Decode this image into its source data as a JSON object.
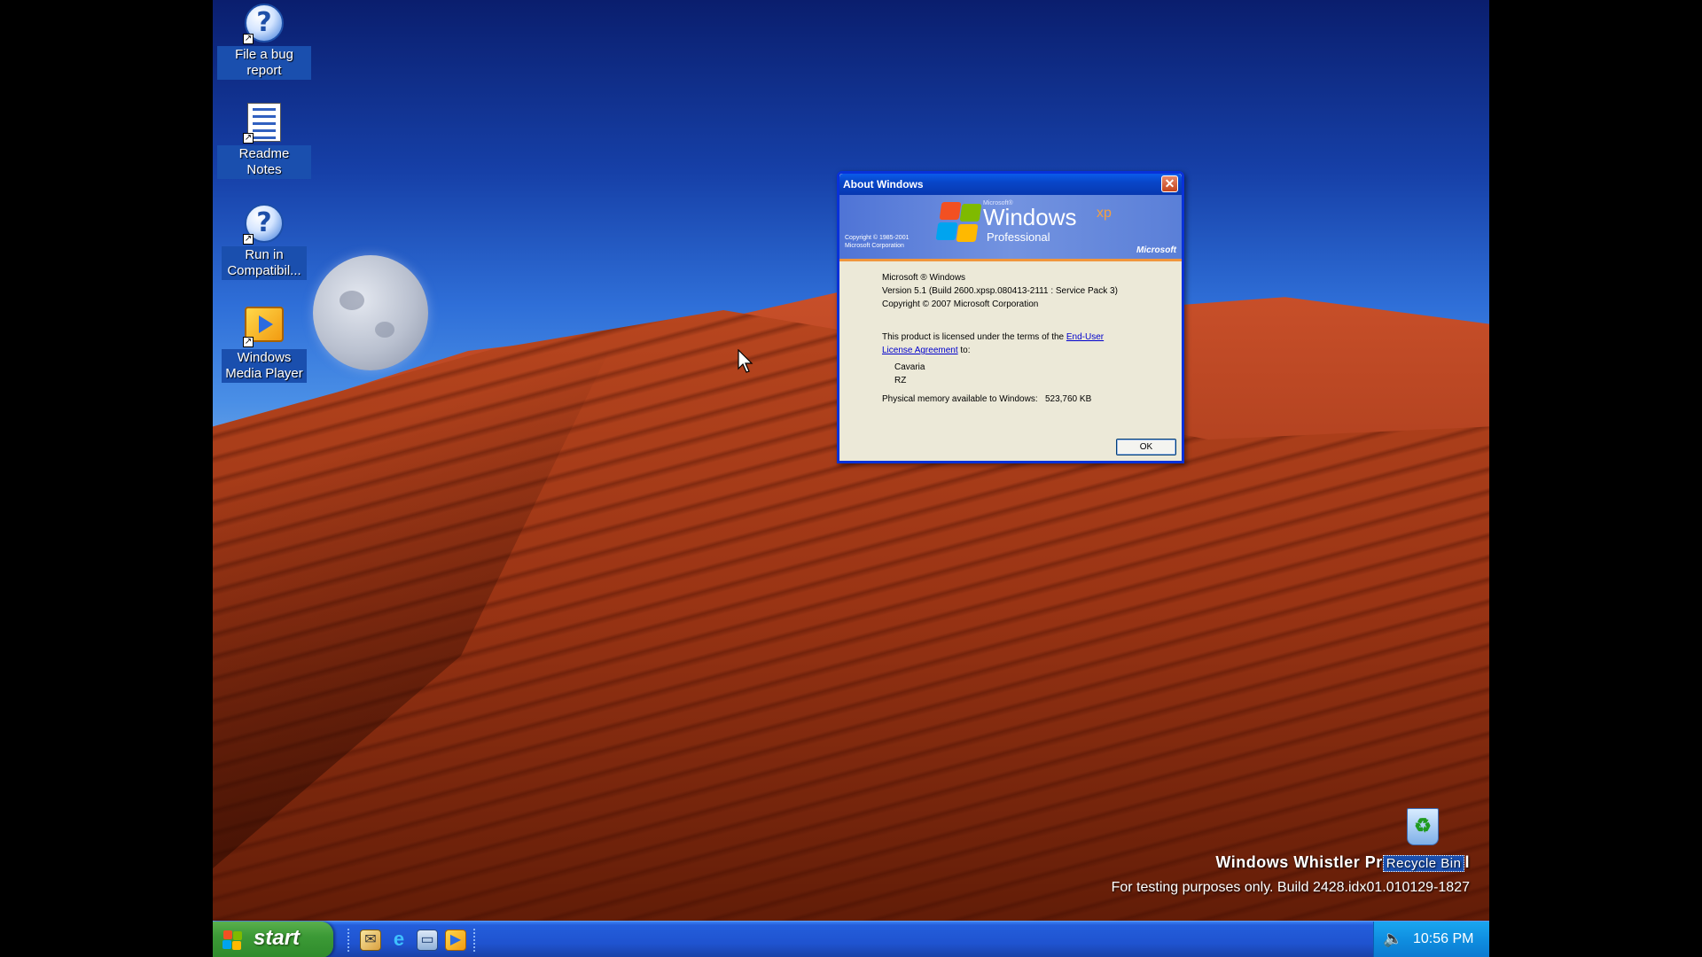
{
  "desktop": {
    "icons": [
      {
        "label": "File a bug report",
        "icon": "help-icon"
      },
      {
        "label": "Readme Notes",
        "icon": "notes-icon"
      },
      {
        "label": "Run in Compatibil...",
        "icon": "help-icon"
      },
      {
        "label": "Windows Media Player",
        "icon": "media-player-icon"
      }
    ],
    "recycle_bin": {
      "label": "Recycle Bin",
      "icon": "recycle-bin-icon"
    }
  },
  "dialog": {
    "title": "About Windows",
    "close_glyph": "✕",
    "banner": {
      "copyright_line1": "Copyright © 1985-2001",
      "copyright_line2": "Microsoft Corporation",
      "microsoft_small": "Microsoft®",
      "windows": "Windows",
      "xp": "xp",
      "edition": "Professional",
      "microsoft_logo": "Microsoft"
    },
    "info_line1": "Microsoft ® Windows",
    "info_line2": "Version 5.1 (Build 2600.xpsp.080413-2111 : Service Pack 3)",
    "info_line3": "Copyright © 2007 Microsoft Corporation",
    "license_text": "This product is licensed under the terms of the ",
    "license_link1": "End-User",
    "license_link2": "License Agreement",
    "license_to": " to:",
    "licensee_name": "Cavaria",
    "licensee_org": "RZ",
    "memory_label": "Physical memory available to Windows:",
    "memory_value": "523,760 KB",
    "ok_label": "OK"
  },
  "watermark": {
    "line1": "Windows Whistler Pr",
    "line1_end": "l",
    "line2": "For testing purposes only. Build 2428.idx01.010129-1827"
  },
  "taskbar": {
    "start_label": "start",
    "quick_launch": [
      "email-icon",
      "internet-explorer-icon",
      "show-desktop-icon",
      "media-player-icon"
    ],
    "clock": "10:56 PM",
    "tray_icon": "volume-icon"
  },
  "colors": {
    "taskbar_blue": "#245edb",
    "start_green": "#3c9a36",
    "tray_blue": "#0f8ee0",
    "title_blue": "#0846c8"
  }
}
